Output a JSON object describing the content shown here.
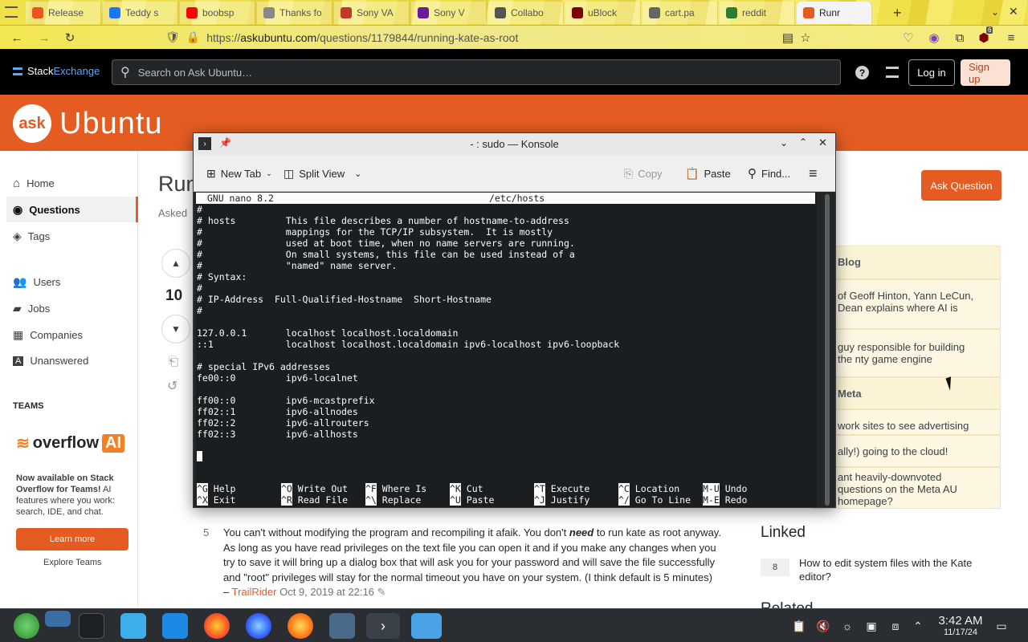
{
  "browser": {
    "tabs": [
      {
        "label": "Release",
        "color": "#e95420"
      },
      {
        "label": "Teddy s",
        "color": "#1877f2"
      },
      {
        "label": "boobsp",
        "color": "#ff0000"
      },
      {
        "label": "Thanks fo",
        "color": "#888888"
      },
      {
        "label": "Sony VA",
        "color": "#c0392b"
      },
      {
        "label": "Sony V",
        "color": "#6a1b9a"
      },
      {
        "label": "Collabo",
        "color": "#555555"
      },
      {
        "label": "uBlock",
        "color": "#800000"
      },
      {
        "label": "cart.pa",
        "color": "#666666"
      },
      {
        "label": "reddit",
        "color": "#2e7d32"
      },
      {
        "label": "Runr",
        "color": "#e45c22"
      }
    ],
    "url_prefix": "https://",
    "url_domain": "askubuntu.com",
    "url_path": "/questions/1179844/running-kate-as-root",
    "ublock_count": "6"
  },
  "se_topbar": {
    "logo_left": "Stack",
    "logo_right": "Exchange",
    "search_placeholder": "Search on Ask Ubuntu…",
    "login": "Log in",
    "signup": "Sign up"
  },
  "site": {
    "logo_bubble": "ask",
    "logo_name": "Ubuntu"
  },
  "leftnav": {
    "items": [
      "Home",
      "Questions",
      "Tags",
      "Users",
      "Jobs",
      "Companies",
      "Unanswered"
    ],
    "teams_heading": "TEAMS",
    "overflow_label": "overflow",
    "overflow_ai": "AI",
    "promo_bold": "Now available on Stack Overflow for Teams!",
    "promo_rest": " AI features where you work: search, IDE, and chat.",
    "learn_more": "Learn more",
    "explore": "Explore Teams"
  },
  "question": {
    "title_fragment": "Run",
    "asked_fragment": "Asked",
    "vote_count": "10",
    "ask_button": "Ask Question"
  },
  "sidebar": {
    "blog_heading": "Blog",
    "blog_item1": "of Geoff Hinton, Yann LeCun, Dean explains where AI is",
    "blog_item2": "guy responsible for building the nty game engine",
    "meta_heading": "Meta",
    "meta_item1": "work sites to see advertising test",
    "meta_item2": "ally!) going to the cloud!",
    "meta_item3": "ant heavily-downvoted questions on the Meta AU homepage?",
    "linked_heading": "Linked",
    "linked_count": "8",
    "linked_item": "How to edit system files with the Kate editor?",
    "related_heading": "Related"
  },
  "konsole": {
    "title": "- : sudo — Konsole",
    "new_tab": "New Tab",
    "split_view": "Split View",
    "copy": "Copy",
    "paste": "Paste",
    "find": "Find...",
    "nano_version": "  GNU nano 8.2",
    "nano_file": "/etc/hosts",
    "file_lines": [
      "#",
      "# hosts         This file describes a number of hostname-to-address",
      "#               mappings for the TCP/IP subsystem.  It is mostly",
      "#               used at boot time, when no name servers are running.",
      "#               On small systems, this file can be used instead of a",
      "#               \"named\" name server.",
      "# Syntax:",
      "#",
      "# IP-Address  Full-Qualified-Hostname  Short-Hostname",
      "#",
      "",
      "127.0.0.1       localhost localhost.localdomain",
      "::1             localhost localhost.localdomain ipv6-localhost ipv6-loopback",
      "",
      "# special IPv6 addresses",
      "fe00::0         ipv6-localnet",
      "",
      "ff00::0         ipv6-mcastprefix",
      "ff02::1         ipv6-allnodes",
      "ff02::2         ipv6-allrouters",
      "ff02::3         ipv6-allhosts"
    ],
    "shortcuts_row1": [
      {
        "key": "^G",
        "label": "Help"
      },
      {
        "key": "^O",
        "label": "Write Out"
      },
      {
        "key": "^F",
        "label": "Where Is"
      },
      {
        "key": "^K",
        "label": "Cut"
      },
      {
        "key": "^T",
        "label": "Execute"
      },
      {
        "key": "^C",
        "label": "Location"
      },
      {
        "key": "M-U",
        "label": "Undo"
      }
    ],
    "shortcuts_row2": [
      {
        "key": "^X",
        "label": "Exit"
      },
      {
        "key": "^R",
        "label": "Read File"
      },
      {
        "key": "^\\",
        "label": "Replace"
      },
      {
        "key": "^U",
        "label": "Paste"
      },
      {
        "key": "^J",
        "label": "Justify"
      },
      {
        "key": "^/",
        "label": "Go To Line"
      },
      {
        "key": "M-E",
        "label": "Redo"
      }
    ]
  },
  "answer": {
    "votes": "5",
    "text_before": "You can't without modifying the program and recompiling it afaik. You don't ",
    "text_em": "need",
    "text_after": " to run kate as root anyway. As long as you have read privileges on the text file you can open it and if you make any changes when you try to save it will bring up a dialog box that will ask you for your password and will save the file successfully and \"root\" privileges will stay for the normal timeout you have on your system. (I think default is 5 minutes)",
    "dash": "– ",
    "author": "TrailRider",
    "date": "Oct 9, 2019 at 22:16"
  },
  "taskbar": {
    "time": "3:42 AM",
    "date": "11/17/24"
  },
  "colors": {
    "accent": "#e45c22",
    "konsole_bg": "#1b1e20"
  }
}
